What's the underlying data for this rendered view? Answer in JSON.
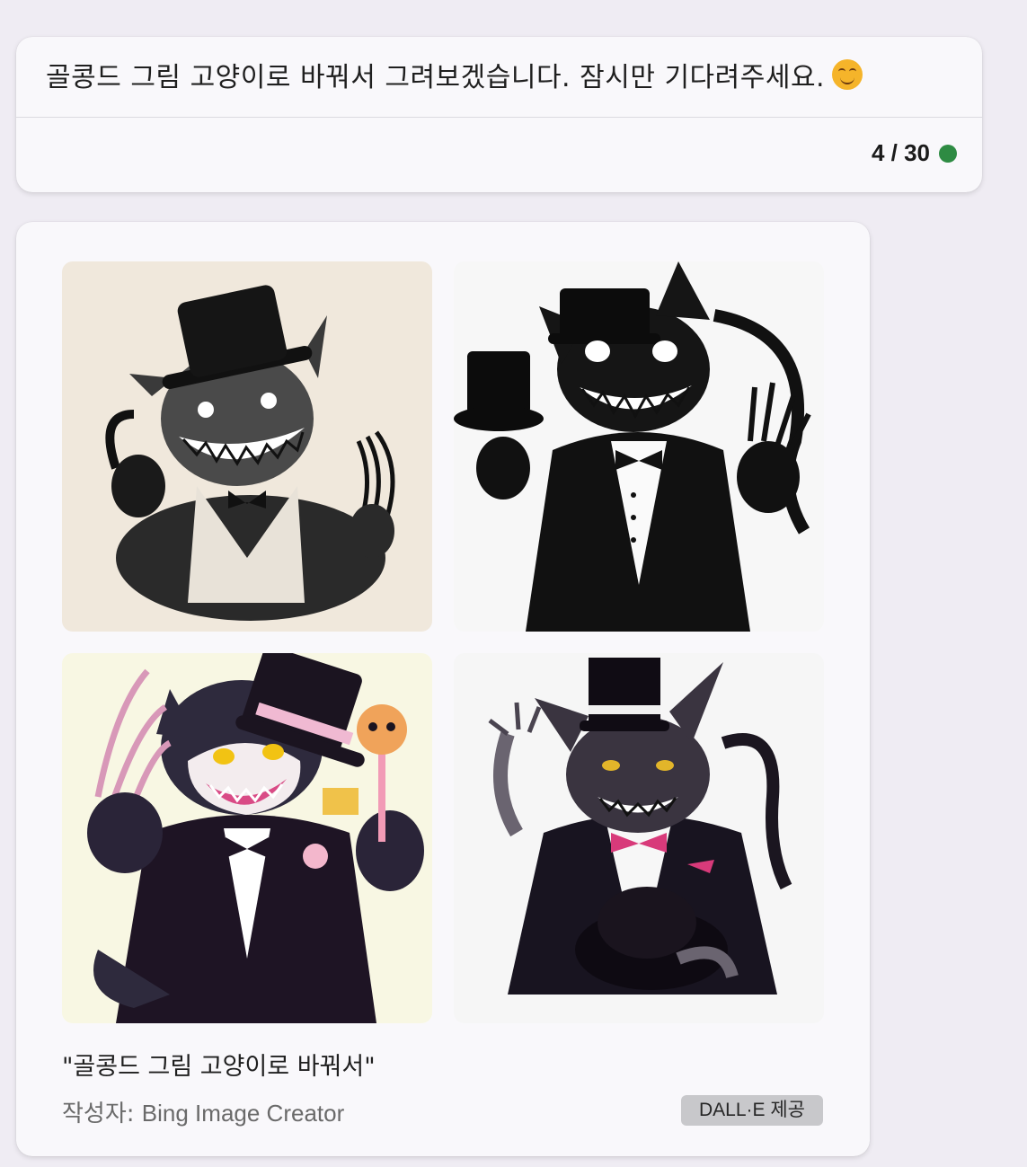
{
  "message": {
    "text": "골콩드 그림 고양이로 바꿔서 그려보겠습니다. 잠시만 기다려주세요.",
    "emoji": "smiling-face-emoji",
    "counter": "4 / 30",
    "status_color": "#2e8b43"
  },
  "image_result": {
    "caption": "\"골콩드 그림 고양이로 바꿔서\"",
    "credit_prefix": "작성자: ",
    "credit_name": "Bing Image Creator",
    "badge": "DALL·E 제공",
    "images": [
      {
        "style": "sepia ink top-hat cat"
      },
      {
        "style": "black and white ink top-hat cat"
      },
      {
        "style": "pink cartoon top-hat cat"
      },
      {
        "style": "ink top-hat cat with pink bow tie"
      }
    ]
  }
}
